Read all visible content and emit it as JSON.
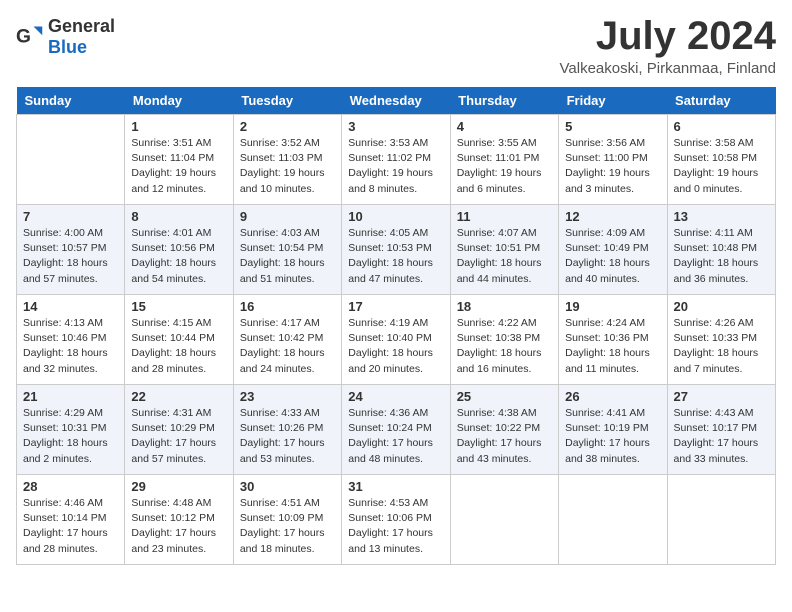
{
  "header": {
    "logo_general": "General",
    "logo_blue": "Blue",
    "title": "July 2024",
    "subtitle": "Valkeakoski, Pirkanmaa, Finland"
  },
  "days_of_week": [
    "Sunday",
    "Monday",
    "Tuesday",
    "Wednesday",
    "Thursday",
    "Friday",
    "Saturday"
  ],
  "weeks": [
    [
      {
        "day": "",
        "info": ""
      },
      {
        "day": "1",
        "info": "Sunrise: 3:51 AM\nSunset: 11:04 PM\nDaylight: 19 hours\nand 12 minutes."
      },
      {
        "day": "2",
        "info": "Sunrise: 3:52 AM\nSunset: 11:03 PM\nDaylight: 19 hours\nand 10 minutes."
      },
      {
        "day": "3",
        "info": "Sunrise: 3:53 AM\nSunset: 11:02 PM\nDaylight: 19 hours\nand 8 minutes."
      },
      {
        "day": "4",
        "info": "Sunrise: 3:55 AM\nSunset: 11:01 PM\nDaylight: 19 hours\nand 6 minutes."
      },
      {
        "day": "5",
        "info": "Sunrise: 3:56 AM\nSunset: 11:00 PM\nDaylight: 19 hours\nand 3 minutes."
      },
      {
        "day": "6",
        "info": "Sunrise: 3:58 AM\nSunset: 10:58 PM\nDaylight: 19 hours\nand 0 minutes."
      }
    ],
    [
      {
        "day": "7",
        "info": "Sunrise: 4:00 AM\nSunset: 10:57 PM\nDaylight: 18 hours\nand 57 minutes."
      },
      {
        "day": "8",
        "info": "Sunrise: 4:01 AM\nSunset: 10:56 PM\nDaylight: 18 hours\nand 54 minutes."
      },
      {
        "day": "9",
        "info": "Sunrise: 4:03 AM\nSunset: 10:54 PM\nDaylight: 18 hours\nand 51 minutes."
      },
      {
        "day": "10",
        "info": "Sunrise: 4:05 AM\nSunset: 10:53 PM\nDaylight: 18 hours\nand 47 minutes."
      },
      {
        "day": "11",
        "info": "Sunrise: 4:07 AM\nSunset: 10:51 PM\nDaylight: 18 hours\nand 44 minutes."
      },
      {
        "day": "12",
        "info": "Sunrise: 4:09 AM\nSunset: 10:49 PM\nDaylight: 18 hours\nand 40 minutes."
      },
      {
        "day": "13",
        "info": "Sunrise: 4:11 AM\nSunset: 10:48 PM\nDaylight: 18 hours\nand 36 minutes."
      }
    ],
    [
      {
        "day": "14",
        "info": "Sunrise: 4:13 AM\nSunset: 10:46 PM\nDaylight: 18 hours\nand 32 minutes."
      },
      {
        "day": "15",
        "info": "Sunrise: 4:15 AM\nSunset: 10:44 PM\nDaylight: 18 hours\nand 28 minutes."
      },
      {
        "day": "16",
        "info": "Sunrise: 4:17 AM\nSunset: 10:42 PM\nDaylight: 18 hours\nand 24 minutes."
      },
      {
        "day": "17",
        "info": "Sunrise: 4:19 AM\nSunset: 10:40 PM\nDaylight: 18 hours\nand 20 minutes."
      },
      {
        "day": "18",
        "info": "Sunrise: 4:22 AM\nSunset: 10:38 PM\nDaylight: 18 hours\nand 16 minutes."
      },
      {
        "day": "19",
        "info": "Sunrise: 4:24 AM\nSunset: 10:36 PM\nDaylight: 18 hours\nand 11 minutes."
      },
      {
        "day": "20",
        "info": "Sunrise: 4:26 AM\nSunset: 10:33 PM\nDaylight: 18 hours\nand 7 minutes."
      }
    ],
    [
      {
        "day": "21",
        "info": "Sunrise: 4:29 AM\nSunset: 10:31 PM\nDaylight: 18 hours\nand 2 minutes."
      },
      {
        "day": "22",
        "info": "Sunrise: 4:31 AM\nSunset: 10:29 PM\nDaylight: 17 hours\nand 57 minutes."
      },
      {
        "day": "23",
        "info": "Sunrise: 4:33 AM\nSunset: 10:26 PM\nDaylight: 17 hours\nand 53 minutes."
      },
      {
        "day": "24",
        "info": "Sunrise: 4:36 AM\nSunset: 10:24 PM\nDaylight: 17 hours\nand 48 minutes."
      },
      {
        "day": "25",
        "info": "Sunrise: 4:38 AM\nSunset: 10:22 PM\nDaylight: 17 hours\nand 43 minutes."
      },
      {
        "day": "26",
        "info": "Sunrise: 4:41 AM\nSunset: 10:19 PM\nDaylight: 17 hours\nand 38 minutes."
      },
      {
        "day": "27",
        "info": "Sunrise: 4:43 AM\nSunset: 10:17 PM\nDaylight: 17 hours\nand 33 minutes."
      }
    ],
    [
      {
        "day": "28",
        "info": "Sunrise: 4:46 AM\nSunset: 10:14 PM\nDaylight: 17 hours\nand 28 minutes."
      },
      {
        "day": "29",
        "info": "Sunrise: 4:48 AM\nSunset: 10:12 PM\nDaylight: 17 hours\nand 23 minutes."
      },
      {
        "day": "30",
        "info": "Sunrise: 4:51 AM\nSunset: 10:09 PM\nDaylight: 17 hours\nand 18 minutes."
      },
      {
        "day": "31",
        "info": "Sunrise: 4:53 AM\nSunset: 10:06 PM\nDaylight: 17 hours\nand 13 minutes."
      },
      {
        "day": "",
        "info": ""
      },
      {
        "day": "",
        "info": ""
      },
      {
        "day": "",
        "info": ""
      }
    ]
  ]
}
